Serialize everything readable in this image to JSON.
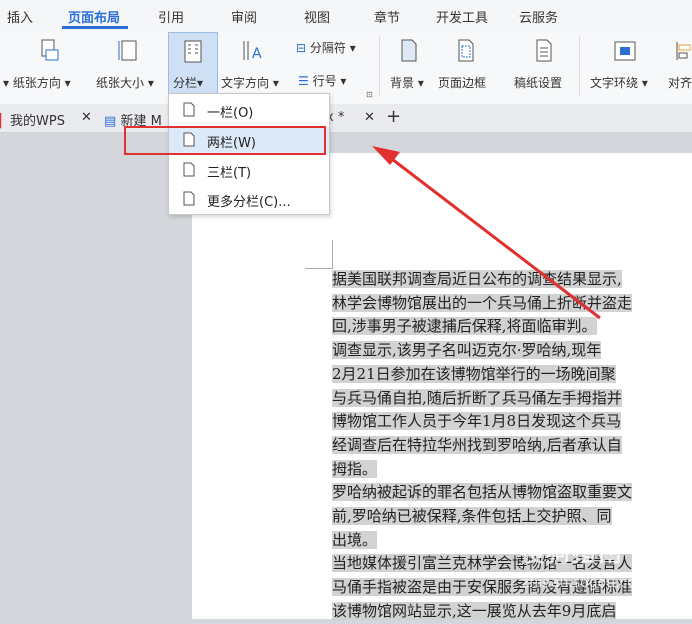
{
  "menu": {
    "tabs": [
      "插入",
      "页面布局",
      "引用",
      "审阅",
      "视图",
      "章节",
      "开发工具",
      "云服务"
    ],
    "active": "页面布局"
  },
  "ribbon": {
    "orientation": "纸张方向",
    "size": "纸张大小",
    "columns": "分栏",
    "text_direction": "文字方向",
    "separator": "分隔符",
    "line_numbers": "行号",
    "background": "背景",
    "page_border": "页面边框",
    "manuscript": "稿纸设置",
    "wrap": "文字环绕",
    "align": "对齐"
  },
  "doc_tabs": {
    "home": "我的WPS",
    "doc": "新建 M",
    "doc2": "x *"
  },
  "dropdown": {
    "items": [
      "一栏(O)",
      "两栏(W)",
      "三栏(T)",
      "更多分栏(C)..."
    ],
    "highlighted": "两栏(W)"
  },
  "document": {
    "lines": [
      "据美国联邦调查局近日公布的调查结果显示,",
      "林学会博物馆展出的一个兵马俑上折断并盗走",
      "回,涉事男子被逮捕后保释,将面临审判。",
      "调查显示,该男子名叫迈克尔·罗哈纳,现年",
      "2月21日参加在该博物馆举行的一场晚间聚",
      "与兵马俑自拍,随后折断了兵马俑左手拇指并",
      "博物馆工作人员于今年1月8日发现这个兵马",
      "经调查后在特拉华州找到罗哈纳,后者承认自",
      "拇指。",
      "罗哈纳被起诉的罪名包括从博物馆盗取重要文",
      "前,罗哈纳已被保释,条件包括上交护照、同",
      "出境。",
      "当地媒体援引富兰克林学会博物馆一名发言人",
      "马俑手指被盗是由于安保服务商没有遵循标准",
      "该博物馆网站显示,这一展览从去年9月底启"
    ]
  },
  "watermark": {
    "main": "搜狗指南",
    "url": "zhinan.sogou.com"
  },
  "colors": {
    "accent": "#2a6fd6",
    "annotation": "#e03030"
  }
}
